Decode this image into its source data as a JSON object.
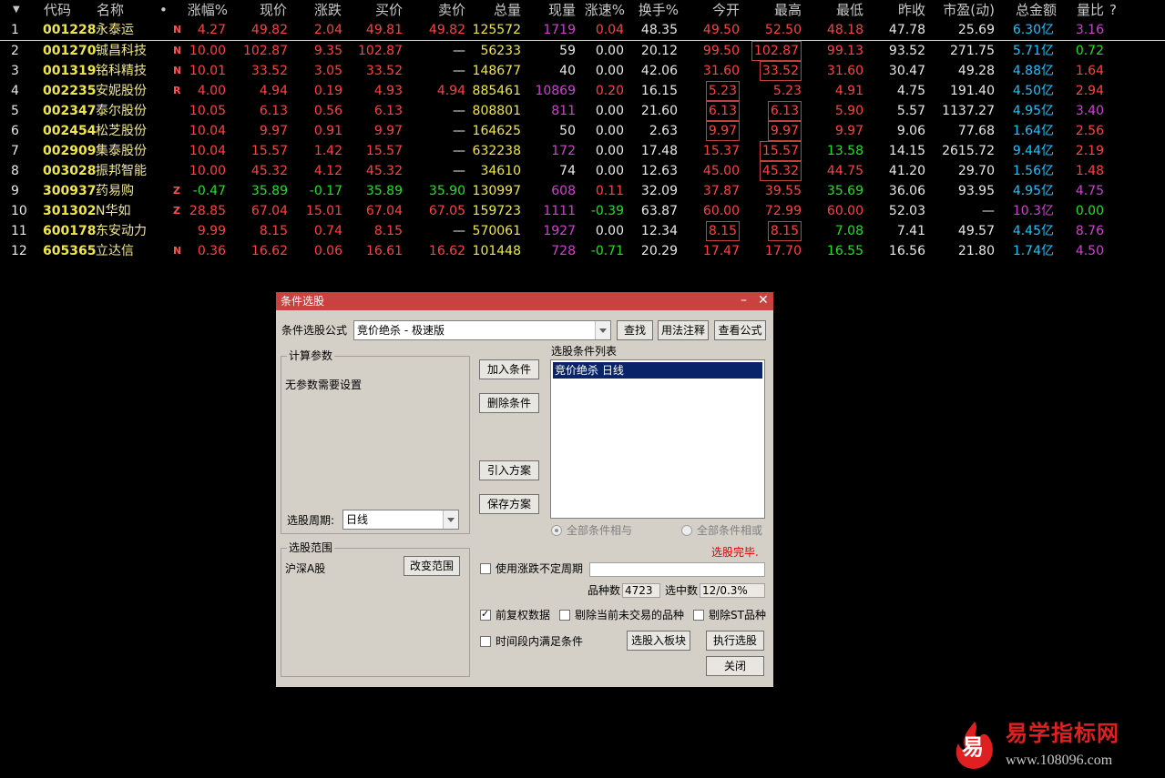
{
  "colors": {
    "up": "#ff4040",
    "down": "#20e020",
    "flat": "#e8e8e8",
    "code": "#f0e64b",
    "name": "#f0e68c",
    "purple": "#d040d0",
    "cyan": "#20c0ff",
    "volume": "#f0e64b"
  },
  "header": {
    "sort_icon": "sort-down-triangle",
    "cols": [
      "代码",
      "名称",
      "•",
      "涨幅%",
      "现价",
      "涨跌",
      "买价",
      "卖价",
      "总量",
      "现量",
      "涨速%",
      "换手%",
      "今开",
      "最高",
      "最低",
      "昨收",
      "市盈(动)",
      "总金额",
      "量比",
      "?"
    ]
  },
  "rows": [
    {
      "idx": "1",
      "code": "001228",
      "name": "永泰运",
      "mark": "N",
      "chg_pct": "4.27",
      "price": "49.82",
      "chg": "2.04",
      "bid": "49.81",
      "ask": "49.82",
      "vol": "125572",
      "cur_vol": "1719",
      "speed": "0.04",
      "turnover": "48.35",
      "open": "49.50",
      "high": "52.50",
      "low": "48.18",
      "prev": "47.78",
      "pe": "25.69",
      "amount": "6.30",
      "amount_unit": "亿",
      "vol_ratio": "3.16"
    },
    {
      "idx": "2",
      "code": "001270",
      "name": "铖昌科技",
      "mark": "N",
      "chg_pct": "10.00",
      "price": "102.87",
      "chg": "9.35",
      "bid": "102.87",
      "ask": "—",
      "vol": "56233",
      "cur_vol": "59",
      "speed": "0.00",
      "turnover": "20.12",
      "open": "99.50",
      "high": "102.87",
      "low": "99.13",
      "prev": "93.52",
      "pe": "271.75",
      "amount": "5.71",
      "amount_unit": "亿",
      "vol_ratio": "0.72"
    },
    {
      "idx": "3",
      "code": "001319",
      "name": "铭科精技",
      "mark": "N",
      "chg_pct": "10.01",
      "price": "33.52",
      "chg": "3.05",
      "bid": "33.52",
      "ask": "—",
      "vol": "148677",
      "cur_vol": "40",
      "speed": "0.00",
      "turnover": "42.06",
      "open": "31.60",
      "high": "33.52",
      "low": "31.60",
      "prev": "30.47",
      "pe": "49.28",
      "amount": "4.88",
      "amount_unit": "亿",
      "vol_ratio": "1.64"
    },
    {
      "idx": "4",
      "code": "002235",
      "name": "安妮股份",
      "mark": "R",
      "chg_pct": "4.00",
      "price": "4.94",
      "chg": "0.19",
      "bid": "4.93",
      "ask": "4.94",
      "vol": "885461",
      "cur_vol": "10869",
      "speed": "0.20",
      "turnover": "16.15",
      "open": "5.23",
      "high": "5.23",
      "low": "4.91",
      "prev": "4.75",
      "pe": "191.40",
      "amount": "4.50",
      "amount_unit": "亿",
      "vol_ratio": "2.94"
    },
    {
      "idx": "5",
      "code": "002347",
      "name": "泰尔股份",
      "mark": "",
      "chg_pct": "10.05",
      "price": "6.13",
      "chg": "0.56",
      "bid": "6.13",
      "ask": "—",
      "vol": "808801",
      "cur_vol": "811",
      "speed": "0.00",
      "turnover": "21.60",
      "open": "6.13",
      "high": "6.13",
      "low": "5.90",
      "prev": "5.57",
      "pe": "1137.27",
      "amount": "4.95",
      "amount_unit": "亿",
      "vol_ratio": "3.40"
    },
    {
      "idx": "6",
      "code": "002454",
      "name": "松芝股份",
      "mark": "",
      "chg_pct": "10.04",
      "price": "9.97",
      "chg": "0.91",
      "bid": "9.97",
      "ask": "—",
      "vol": "164625",
      "cur_vol": "50",
      "speed": "0.00",
      "turnover": "2.63",
      "open": "9.97",
      "high": "9.97",
      "low": "9.97",
      "prev": "9.06",
      "pe": "77.68",
      "amount": "1.64",
      "amount_unit": "亿",
      "vol_ratio": "2.56"
    },
    {
      "idx": "7",
      "code": "002909",
      "name": "集泰股份",
      "mark": "",
      "chg_pct": "10.04",
      "price": "15.57",
      "chg": "1.42",
      "bid": "15.57",
      "ask": "—",
      "vol": "632238",
      "cur_vol": "172",
      "speed": "0.00",
      "turnover": "17.48",
      "open": "15.37",
      "high": "15.57",
      "low": "13.58",
      "prev": "14.15",
      "pe": "2615.72",
      "amount": "9.44",
      "amount_unit": "亿",
      "vol_ratio": "2.19"
    },
    {
      "idx": "8",
      "code": "003028",
      "name": "振邦智能",
      "mark": "",
      "chg_pct": "10.00",
      "price": "45.32",
      "chg": "4.12",
      "bid": "45.32",
      "ask": "—",
      "vol": "34610",
      "cur_vol": "74",
      "speed": "0.00",
      "turnover": "12.63",
      "open": "45.00",
      "high": "45.32",
      "low": "44.75",
      "prev": "41.20",
      "pe": "29.70",
      "amount": "1.56",
      "amount_unit": "亿",
      "vol_ratio": "1.48"
    },
    {
      "idx": "9",
      "code": "300937",
      "name": "药易购",
      "mark": "Z",
      "chg_pct": "-0.47",
      "price": "35.89",
      "chg": "-0.17",
      "bid": "35.89",
      "ask": "35.90",
      "vol": "130997",
      "cur_vol": "608",
      "speed": "0.11",
      "turnover": "32.09",
      "open": "37.87",
      "high": "39.55",
      "low": "35.69",
      "prev": "36.06",
      "pe": "93.95",
      "amount": "4.95",
      "amount_unit": "亿",
      "vol_ratio": "4.75"
    },
    {
      "idx": "10",
      "code": "301302",
      "name": "N华如",
      "mark": "Z",
      "chg_pct": "28.85",
      "price": "67.04",
      "chg": "15.01",
      "bid": "67.04",
      "ask": "67.05",
      "vol": "159723",
      "cur_vol": "1111",
      "speed": "-0.39",
      "turnover": "63.87",
      "open": "60.00",
      "high": "72.99",
      "low": "60.00",
      "prev": "52.03",
      "pe": "—",
      "amount": "10.3",
      "amount_unit": "亿",
      "vol_ratio": "0.00"
    },
    {
      "idx": "11",
      "code": "600178",
      "name": "东安动力",
      "mark": "",
      "chg_pct": "9.99",
      "price": "8.15",
      "chg": "0.74",
      "bid": "8.15",
      "ask": "—",
      "vol": "570061",
      "cur_vol": "1927",
      "speed": "0.00",
      "turnover": "12.34",
      "open": "8.15",
      "high": "8.15",
      "low": "7.08",
      "prev": "7.41",
      "pe": "49.57",
      "amount": "4.45",
      "amount_unit": "亿",
      "vol_ratio": "8.76"
    },
    {
      "idx": "12",
      "code": "605365",
      "name": "立达信",
      "mark": "N",
      "chg_pct": "0.36",
      "price": "16.62",
      "chg": "0.06",
      "bid": "16.61",
      "ask": "16.62",
      "vol": "101448",
      "cur_vol": "728",
      "speed": "-0.71",
      "turnover": "20.29",
      "open": "17.47",
      "high": "17.70",
      "low": "16.55",
      "prev": "16.56",
      "pe": "21.80",
      "amount": "1.74",
      "amount_unit": "亿",
      "vol_ratio": "4.50"
    }
  ],
  "dialog": {
    "title": "条件选股",
    "formula_label": "条件选股公式",
    "formula_value": "竞价绝杀    - 极速版",
    "find": "查找",
    "usage": "用法注释",
    "view_formula": "查看公式",
    "params_group": "计算参数",
    "no_params": "无参数需要设置",
    "period_label": "选股周期:",
    "period_value": "日线",
    "range_group": "选股范围",
    "range_value": "沪深A股",
    "change_range": "改变范围",
    "add_cond": "加入条件",
    "del_cond": "删除条件",
    "import_plan": "引入方案",
    "save_plan": "保存方案",
    "cond_list_label": "选股条件列表",
    "cond_items": [
      "竞价绝杀  日线"
    ],
    "all_and": "全部条件相与",
    "all_or": "全部条件相或",
    "status": "选股完毕.",
    "use_irregular": "使用涨跌不定周期",
    "count_label": "品种数",
    "count_value": "4723",
    "selected_label": "选中数",
    "selected_value": "12/0.3%",
    "adjust": "前复权数据",
    "exclude_no_trade": "剔除当前未交易的品种",
    "exclude_st": "剔除ST品种",
    "time_range": "时间段内满足条件",
    "to_block": "选股入板块",
    "execute": "执行选股",
    "close": "关闭"
  },
  "logo": {
    "mark": "易",
    "name": "易学指标网",
    "url": "www.108096.com"
  }
}
